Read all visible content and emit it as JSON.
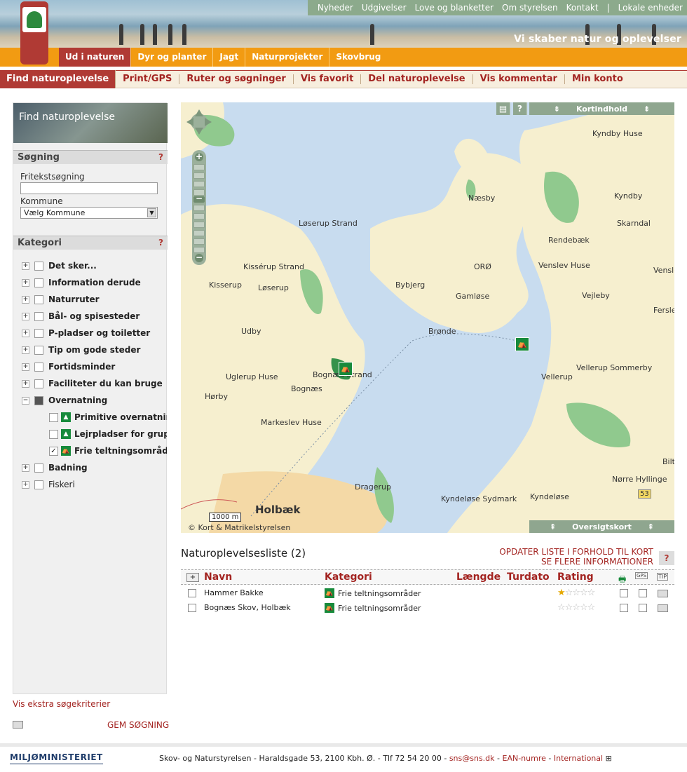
{
  "top_nav": [
    "Nyheder",
    "Udgivelser",
    "Love og blanketter",
    "Om styrelsen",
    "Kontakt",
    "|",
    "Lokale enheder"
  ],
  "slogan": "Vi skaber natur og oplevelser",
  "main_nav": [
    {
      "label": "Ud i naturen",
      "active": true
    },
    {
      "label": "Dyr og planter"
    },
    {
      "label": "Jagt"
    },
    {
      "label": "Naturprojekter"
    },
    {
      "label": "Skovbrug"
    }
  ],
  "sub_nav": [
    {
      "label": "Find naturoplevelse",
      "active": true
    },
    {
      "label": "Print/GPS"
    },
    {
      "label": "Ruter og søgninger"
    },
    {
      "label": "Vis favorit"
    },
    {
      "label": "Del naturoplevelse"
    },
    {
      "label": "Vis kommentar"
    },
    {
      "label": "Min konto"
    }
  ],
  "sidebar": {
    "find_title": "Find naturoplevelse",
    "search": {
      "heading": "Søgning",
      "help": "?",
      "free_text_label": "Fritekstsøgning",
      "free_text_value": "",
      "kommune_label": "Kommune",
      "kommune_selected": "Vælg Kommune"
    },
    "category": {
      "heading": "Kategori",
      "help": "?",
      "items": [
        {
          "label": "Det sker...",
          "expander": "+"
        },
        {
          "label": "Information derude",
          "expander": "+"
        },
        {
          "label": "Naturruter",
          "expander": "+"
        },
        {
          "label": "Bål- og spisesteder",
          "expander": "+"
        },
        {
          "label": "P-pladser og toiletter",
          "expander": "+"
        },
        {
          "label": "Tip om gode steder",
          "expander": "+"
        },
        {
          "label": "Fortidsminder",
          "expander": "+"
        },
        {
          "label": "Faciliteter du kan bruge",
          "expander": "+"
        },
        {
          "label": "Overnatning",
          "expander": "−",
          "filled": true
        },
        {
          "label": "Badning",
          "expander": "+"
        },
        {
          "label": "Fiskeri",
          "expander": "+",
          "normal": true
        }
      ],
      "sub_items": [
        {
          "label": "Primitive overnatningssteder",
          "checked": false
        },
        {
          "label": "Lejrpladser for grupper",
          "checked": false
        },
        {
          "label": "Frie teltningsområder",
          "checked": true
        }
      ]
    },
    "extra_link": "Vis ekstra søgekriterier",
    "save_link": "GEM SØGNING"
  },
  "map": {
    "kortindhold": "Kortindhold",
    "oversigtskort": "Oversigtskort",
    "help": "?",
    "copyright": "© Kort & Matrikelstyrelsen",
    "scale": "1000 m",
    "places": [
      "Kyndby Huse",
      "Næsby",
      "Kyndby",
      "Skarndal",
      "Løserup Strand",
      "Rendebæk",
      "ORØ",
      "Venslev Huse",
      "Kissérup Strand",
      "Venslev",
      "Kisserup",
      "Løserup",
      "Bybjerg",
      "Gamløse",
      "Vejleby",
      "Ferslev",
      "Udby",
      "Brønde",
      "Bognæs Strand",
      "Vellerup Sommerby",
      "Uglerup Huse",
      "Vellerup",
      "Hørby",
      "Bognæs",
      "Markeslev Huse",
      "Bilt",
      "Nørre Hyllinge",
      "Dragerup",
      "Kyndeløse Sydmark",
      "Kyndeløse",
      "Holbæk",
      "53"
    ]
  },
  "list": {
    "title": "Naturoplevelsesliste (2)",
    "update_link": "OPDATER LISTE I FORHOLD TIL KORT",
    "more_link": "SE FLERE INFORMATIONER",
    "help": "?",
    "columns": [
      "Navn",
      "Kategori",
      "Længde",
      "Turdato",
      "Rating"
    ],
    "col_icons": [
      "GPS",
      "TIP"
    ],
    "rows": [
      {
        "name": "Hammer Bakke",
        "category": "Frie teltningsområder",
        "rating": 1
      },
      {
        "name": "Bognæs Skov, Holbæk",
        "category": "Frie teltningsområder",
        "rating": 0
      }
    ]
  },
  "footer": {
    "logo": "MILJØMINISTERIET",
    "text": "Skov- og Naturstyrelsen  -  Haraldsgade 53, 2100 Kbh. Ø.  -  Tlf 72 54 20 00  -",
    "email": "sns@sns.dk",
    "ean": "EAN-numre",
    "international": "International"
  }
}
